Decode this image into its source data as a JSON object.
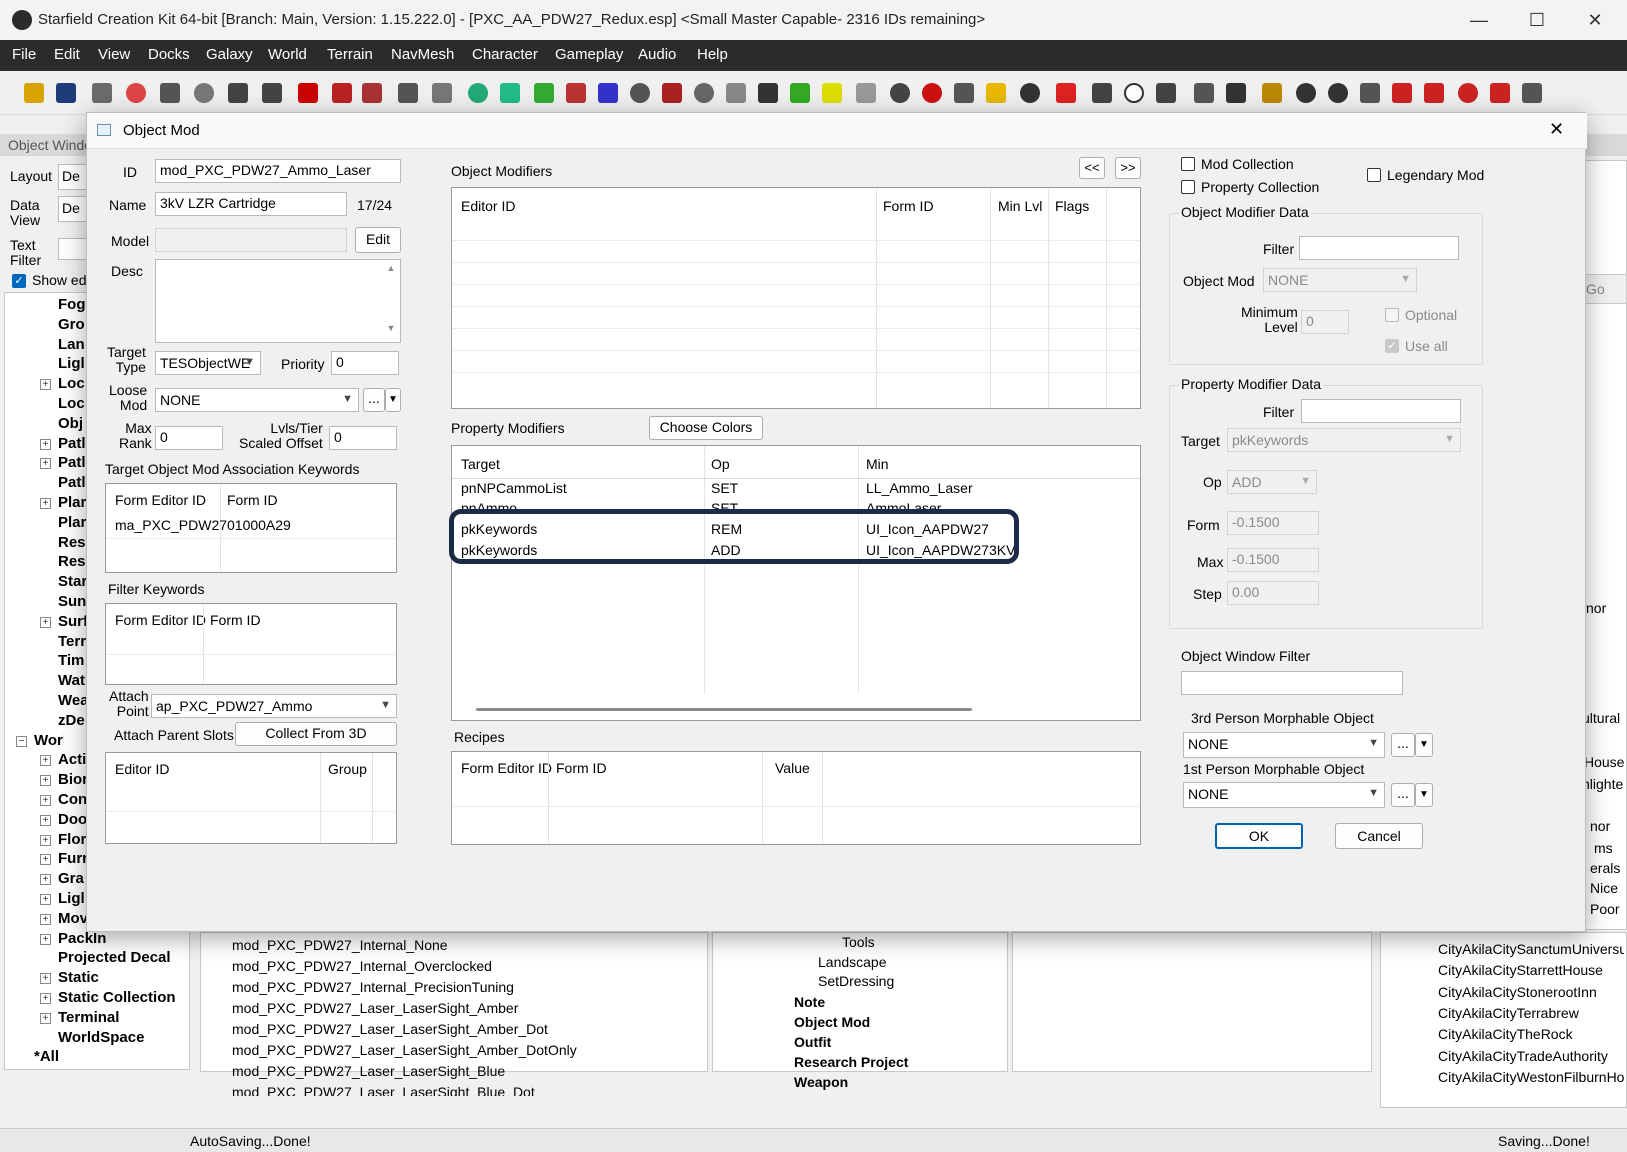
{
  "window": {
    "title": "Starfield Creation Kit 64-bit [Branch: Main, Version: 1.15.222.0] - [PXC_AA_PDW27_Redux.esp] <Small Master Capable- 2316 IDs remaining>",
    "minimize": "—",
    "maximize": "☐",
    "close": "✕"
  },
  "menu": [
    "File",
    "Edit",
    "View",
    "Docks",
    "Galaxy",
    "World",
    "Terrain",
    "NavMesh",
    "Character",
    "Gameplay",
    "Audio",
    "Help"
  ],
  "object_window": {
    "title": "Object Windo",
    "layout_label": "Layout",
    "layout_value": "De",
    "dataview_label": "Data\nView",
    "dataview_value": "De",
    "textfilter_label": "Text\nFilter",
    "show_label": "Show ed",
    "tree": [
      "Fog",
      "Gro",
      "Lan",
      "Ligl",
      "Loc",
      "Loc",
      "Obj",
      "Patl",
      "Patl",
      "Patl",
      "Plar",
      "Plar",
      "Res",
      "Res",
      "Star",
      "Sun",
      "Surf",
      "Terr",
      "Tim",
      "Wat",
      "Wea",
      "zDe",
      "WorldO",
      "Acti",
      "Bior",
      "Con",
      "Doo",
      "Flor",
      "Furr",
      "Gra",
      "Ligl",
      "MovableStatic",
      "PackIn",
      "Projected Decal",
      "Static",
      "Static Collection",
      "Terminal",
      "WorldSpace",
      "*All"
    ]
  },
  "bottom_list": {
    "items": [
      "mod_PXC_PDW27_Internal_None",
      "mod_PXC_PDW27_Internal_Overclocked",
      "mod_PXC_PDW27_Internal_PrecisionTuning",
      "mod_PXC_PDW27_Laser_LaserSight_Amber",
      "mod_PXC_PDW27_Laser_LaserSight_Amber_Dot",
      "mod_PXC_PDW27_Laser_LaserSight_Amber_DotOnly",
      "mod_PXC_PDW27_Laser_LaserSight_Blue",
      "mod_PXC_PDW27_Laser_LaserSight_Blue_Dot"
    ]
  },
  "bottom_tree": {
    "items": [
      "Tools",
      "Landscape",
      "SetDressing",
      "Note",
      "Object Mod",
      "Outfit",
      "Research Project",
      "Weapon"
    ]
  },
  "right_list": {
    "items": [
      "CityAkilaCitySanctumUniversum",
      "CityAkilaCityStarrettHouse",
      "CityAkilaCityStonerootInn",
      "CityAkilaCityTerrabrew",
      "CityAkilaCityTheRock",
      "CityAkilaCityTradeAuthority",
      "CityAkilaCityWestonFilburnHous"
    ],
    "partials": [
      "Go",
      "nor",
      "ultural",
      "House",
      "nlighte",
      "nor",
      "ms",
      "erals",
      "Nice",
      "Poor"
    ]
  },
  "status": {
    "left": "AutoSaving...Done!",
    "right": "Saving...Done!"
  },
  "dialog": {
    "title": "Object Mod",
    "close": "✕",
    "id_label": "ID",
    "id_value": "mod_PXC_PDW27_Ammo_Laser",
    "name_label": "Name",
    "name_value": "3kV LZR Cartridge",
    "name_count": "17/24",
    "model_label": "Model",
    "edit_button": "Edit",
    "desc_label": "Desc",
    "target_type_label": "Target\nType",
    "target_type_value": "TESObjectWE",
    "priority_label": "Priority",
    "priority_value": "0",
    "loose_mod_label": "Loose\nMod",
    "loose_mod_value": "NONE",
    "ellipsis": "...",
    "max_rank_label": "Max\nRank",
    "max_rank_value": "0",
    "lvls_label": "Lvls/Tier\nScaled Offset",
    "lvls_value": "0",
    "assoc_keywords_label": "Target Object Mod Association Keywords",
    "assoc_columns": [
      "Form Editor ID",
      "Form ID"
    ],
    "assoc_rows": [
      [
        "ma_PXC_PDW27",
        "01000A29"
      ]
    ],
    "filter_keywords_label": "Filter Keywords",
    "filter_columns": [
      "Form Editor ID",
      "Form ID"
    ],
    "attach_point_label": "Attach\nPoint",
    "attach_point_value": "ap_PXC_PDW27_Ammo",
    "attach_parent_label": "Attach Parent Slots",
    "collect_button": "Collect From 3D",
    "parent_columns": [
      "Editor ID",
      "Group"
    ],
    "object_modifiers_label": "Object Modifiers",
    "prev_button": "<<",
    "next_button": ">>",
    "object_mod_columns": [
      "Editor ID",
      "Form ID",
      "Min Lvl",
      "Flags"
    ],
    "property_modifiers_label": "Property Modifiers",
    "choose_colors_button": "Choose Colors",
    "prop_columns": [
      "Target",
      "Op",
      "Min"
    ],
    "prop_rows": [
      [
        "pnNPCammoList",
        "SET",
        "LL_Ammo_Laser"
      ],
      [
        "pnAmmo",
        "SET",
        "AmmoLaser"
      ],
      [
        "pkKeywords",
        "REM",
        "UI_Icon_AAPDW27"
      ],
      [
        "pkKeywords",
        "ADD",
        "UI_Icon_AAPDW273KV"
      ]
    ],
    "recipes_label": "Recipes",
    "recipe_columns": [
      "Form Editor ID",
      "Form ID",
      "Value"
    ],
    "mod_collection_label": "Mod Collection",
    "property_collection_label": "Property Collection",
    "legendary_mod_label": "Legendary Mod",
    "omd_group_label": "Object Modifier Data",
    "omd_filter_label": "Filter",
    "omd_object_mod_label": "Object Mod",
    "omd_object_mod_value": "NONE",
    "omd_min_level_label": "Minimum\nLevel",
    "omd_min_level_value": "0",
    "omd_optional_label": "Optional",
    "omd_useall_label": "Use all",
    "pmd_group_label": "Property Modifier Data",
    "pmd_filter_label": "Filter",
    "pmd_target_label": "Target",
    "pmd_target_value": "pkKeywords",
    "pmd_op_label": "Op",
    "pmd_op_value": "ADD",
    "pmd_form_label": "Form",
    "pmd_form_value": "-0.1500",
    "pmd_max_label": "Max",
    "pmd_max_value": "-0.1500",
    "pmd_step_label": "Step",
    "pmd_step_value": "0.00",
    "owf_label": "Object Window Filter",
    "third_person_label": "3rd Person Morphable Object",
    "third_person_value": "NONE",
    "first_person_label": "1st Person Morphable Object",
    "first_person_value": "NONE",
    "ok_button": "OK",
    "cancel_button": "Cancel"
  },
  "colors": {
    "highlight_border": "#1b2a47",
    "menubar": "#2b2b2b",
    "checkbox_accent": "#0067c0"
  }
}
